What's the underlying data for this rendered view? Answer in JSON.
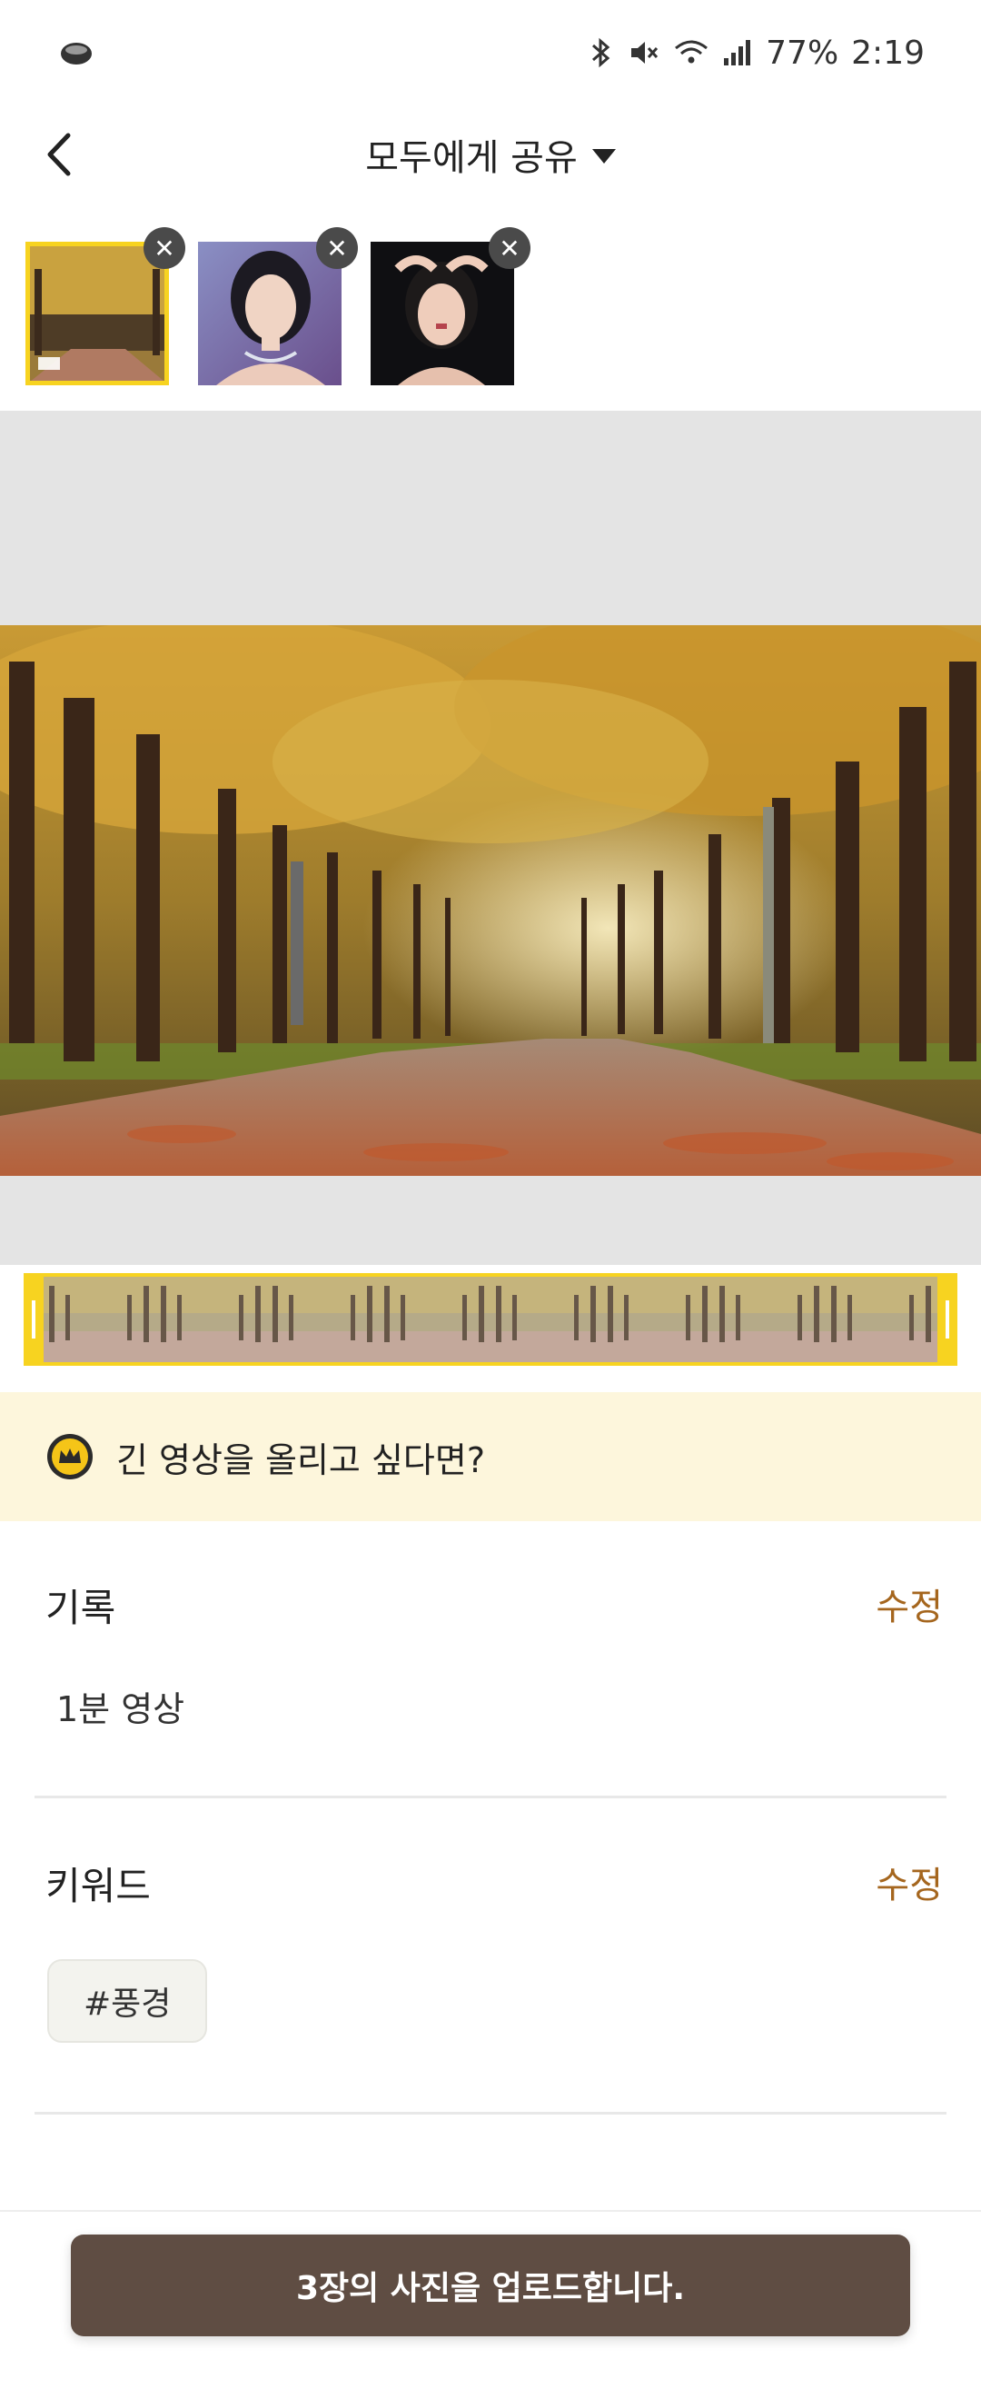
{
  "status_bar": {
    "battery": "77%",
    "time": "2:19"
  },
  "header": {
    "share_scope": "모두에게 공유"
  },
  "banner": {
    "text": "긴 영상을 올리고 싶다면?"
  },
  "record": {
    "title": "기록",
    "edit_label": "수정",
    "value": "1분 영상"
  },
  "keyword": {
    "title": "키워드",
    "edit_label": "수정",
    "tags": [
      "#풍경"
    ]
  },
  "upload_button": {
    "label": "3장의 사진을 업로드합니다."
  },
  "colors": {
    "accent_yellow": "#f7d320",
    "edit_brown": "#a5661e",
    "button_brown": "#5f4d43",
    "banner_bg": "#fdf6dc"
  }
}
